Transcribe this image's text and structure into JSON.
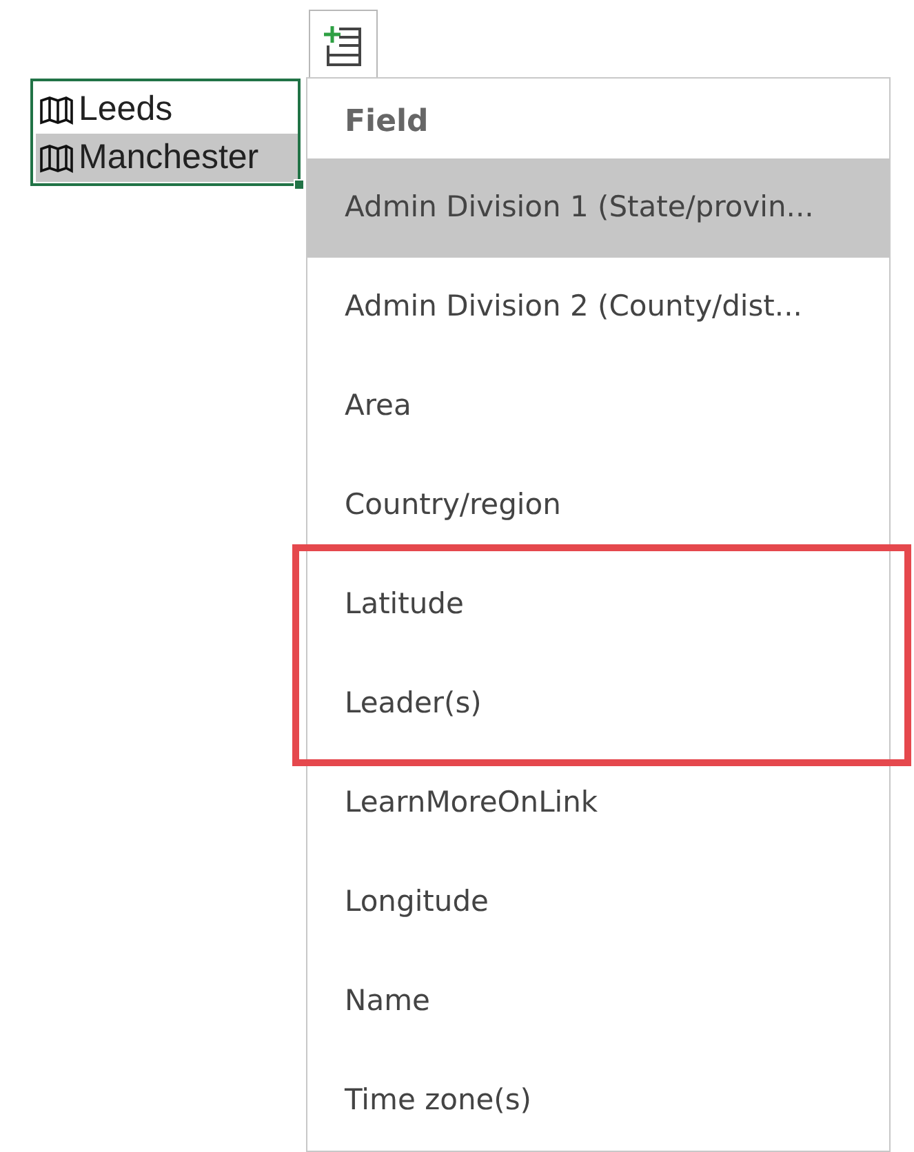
{
  "cells": [
    {
      "text": "Leeds",
      "selected": false
    },
    {
      "text": "Manchester",
      "selected": true
    }
  ],
  "field_menu": {
    "header": "Field",
    "items": [
      {
        "label": "Admin Division 1 (State/provin...",
        "selected": true,
        "highlighted": false
      },
      {
        "label": "Admin Division 2 (County/dist...",
        "selected": false,
        "highlighted": false
      },
      {
        "label": "Area",
        "selected": false,
        "highlighted": false
      },
      {
        "label": "Country/region",
        "selected": false,
        "highlighted": false
      },
      {
        "label": "Latitude",
        "selected": false,
        "highlighted": true
      },
      {
        "label": "Leader(s)",
        "selected": false,
        "highlighted": true
      },
      {
        "label": "LearnMoreOnLink",
        "selected": false,
        "highlighted": false
      },
      {
        "label": "Longitude",
        "selected": false,
        "highlighted": false
      },
      {
        "label": "Name",
        "selected": false,
        "highlighted": false
      },
      {
        "label": "Time zone(s)",
        "selected": false,
        "highlighted": false
      }
    ]
  }
}
